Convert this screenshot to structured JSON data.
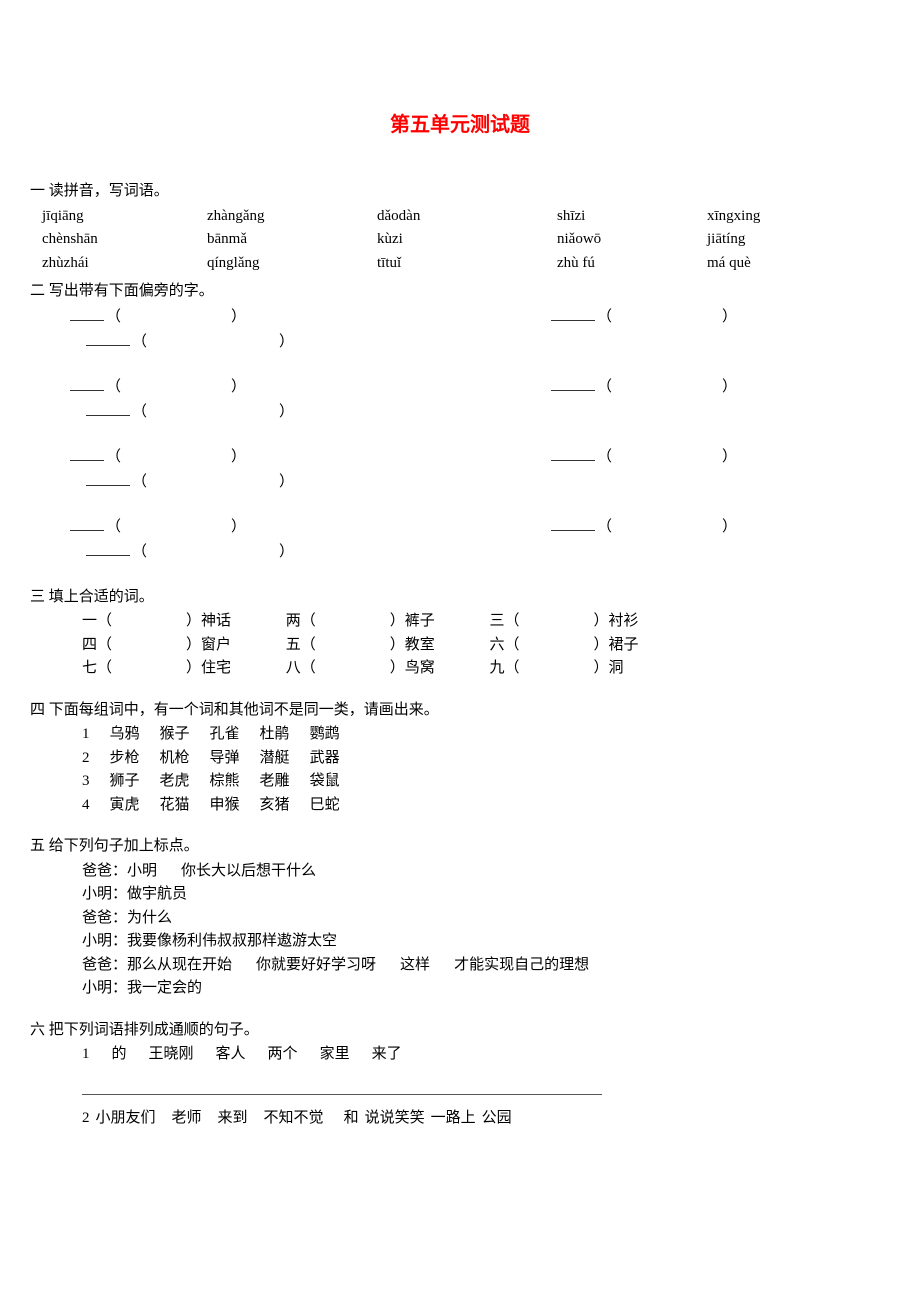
{
  "title": "第五单元测试题",
  "sections": {
    "s1": {
      "heading": "一 读拼音，写词语。",
      "rows": [
        [
          "jīqiāng",
          "zhàngǎng",
          "dǎodàn",
          "shīzi",
          "xīngxing"
        ],
        [
          "chènshān",
          "bānmǎ",
          "kùzi",
          "niǎowō",
          "jiātíng"
        ],
        [
          "zhùzhái",
          "qínglǎng",
          "tītuǐ",
          "zhù fú",
          "má què"
        ]
      ]
    },
    "s2": {
      "heading": "二 写出带有下面偏旁的字。"
    },
    "s3": {
      "heading": "三 填上合适的词。",
      "rows": [
        [
          [
            "一",
            "神话"
          ],
          [
            "两",
            "裤子"
          ],
          [
            "三",
            "衬衫"
          ]
        ],
        [
          [
            "四",
            "窗户"
          ],
          [
            "五",
            "教室"
          ],
          [
            "六",
            "裙子"
          ]
        ],
        [
          [
            "七",
            "住宅"
          ],
          [
            "八",
            "鸟窝"
          ],
          [
            "九",
            "洞"
          ]
        ]
      ]
    },
    "s4": {
      "heading": "四 下面每组词中，有一个词和其他词不是同一类，请画出来。",
      "rows": [
        [
          "1",
          "乌鸦",
          "猴子",
          "孔雀",
          "杜鹃",
          "鹦鹉"
        ],
        [
          "2",
          "步枪",
          "机枪",
          "导弹",
          "潜艇",
          "武器"
        ],
        [
          "3",
          "狮子",
          "老虎",
          "棕熊",
          "老雕",
          "袋鼠"
        ],
        [
          "4",
          "寅虎",
          "花猫",
          "申猴",
          "亥猪",
          "巳蛇"
        ]
      ]
    },
    "s5": {
      "heading": "五 给下列句子加上标点。",
      "lines": [
        [
          [
            "爸爸："
          ],
          [
            "小明",
            "你长大以后想干什么"
          ]
        ],
        [
          [
            "小明："
          ],
          [
            "做宇航员"
          ]
        ],
        [
          [
            "爸爸："
          ],
          [
            "为什么"
          ]
        ],
        [
          [
            "小明："
          ],
          [
            "我要像杨利伟叔叔那样遨游太空"
          ]
        ],
        [
          [
            "爸爸："
          ],
          [
            "那么从现在开始",
            "你就要好好学习呀",
            "这样",
            "才能实现自己的理想"
          ]
        ],
        [
          [
            "小明："
          ],
          [
            "我一定会的"
          ]
        ]
      ]
    },
    "s6": {
      "heading": "六 把下列词语排列成通顺的句子。",
      "q1": [
        "1",
        "的",
        "王晓刚",
        "客人",
        "两个",
        "家里",
        "来了"
      ],
      "q2": [
        "2",
        "小朋友们",
        "老师",
        "来到",
        "不知不觉",
        "和",
        "说说笑笑",
        "一路上",
        "公园"
      ]
    }
  }
}
